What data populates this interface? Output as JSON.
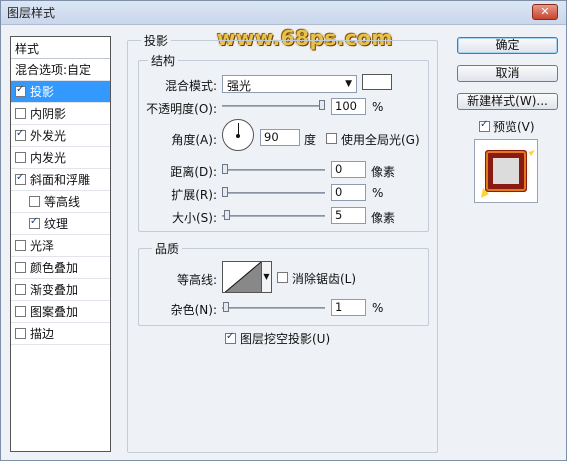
{
  "window": {
    "title": "图层样式",
    "close_icon": "close-icon"
  },
  "watermark": "www.68ps.com",
  "styles_panel": {
    "header": "样式",
    "items": [
      {
        "label": "混合选项:自定",
        "checkbox": false,
        "checked": false,
        "selected": false,
        "indent": false
      },
      {
        "label": "投影",
        "checkbox": true,
        "checked": true,
        "selected": true,
        "indent": false
      },
      {
        "label": "内阴影",
        "checkbox": true,
        "checked": false,
        "selected": false,
        "indent": false
      },
      {
        "label": "外发光",
        "checkbox": true,
        "checked": true,
        "selected": false,
        "indent": false
      },
      {
        "label": "内发光",
        "checkbox": true,
        "checked": false,
        "selected": false,
        "indent": false
      },
      {
        "label": "斜面和浮雕",
        "checkbox": true,
        "checked": true,
        "selected": false,
        "indent": false
      },
      {
        "label": "等高线",
        "checkbox": true,
        "checked": false,
        "selected": false,
        "indent": true
      },
      {
        "label": "纹理",
        "checkbox": true,
        "checked": true,
        "selected": false,
        "indent": true
      },
      {
        "label": "光泽",
        "checkbox": true,
        "checked": false,
        "selected": false,
        "indent": false
      },
      {
        "label": "颜色叠加",
        "checkbox": true,
        "checked": false,
        "selected": false,
        "indent": false
      },
      {
        "label": "渐变叠加",
        "checkbox": true,
        "checked": false,
        "selected": false,
        "indent": false
      },
      {
        "label": "图案叠加",
        "checkbox": true,
        "checked": false,
        "selected": false,
        "indent": false
      },
      {
        "label": "描边",
        "checkbox": true,
        "checked": false,
        "selected": false,
        "indent": false
      }
    ]
  },
  "drop_shadow": {
    "section_title": "投影",
    "structure": {
      "title": "结构",
      "blend_mode_label": "混合模式:",
      "blend_mode_value": "强光",
      "shadow_color": "#ffffff",
      "opacity_label": "不透明度(O):",
      "opacity_value": "100",
      "opacity_unit": "%",
      "opacity_fraction": 1.0,
      "angle_label": "角度(A):",
      "angle_value": "90",
      "angle_unit": "度",
      "global_light_label": "使用全局光(G)",
      "global_light_checked": false,
      "distance_label": "距离(D):",
      "distance_value": "0",
      "distance_unit": "像素",
      "distance_fraction": 0.0,
      "spread_label": "扩展(R):",
      "spread_value": "0",
      "spread_unit": "%",
      "spread_fraction": 0.0,
      "size_label": "大小(S):",
      "size_value": "5",
      "size_unit": "像素",
      "size_fraction": 0.02
    },
    "quality": {
      "title": "品质",
      "contour_label": "等高线:",
      "anti_alias_label": "消除锯齿(L)",
      "anti_alias_checked": false,
      "noise_label": "杂色(N):",
      "noise_value": "1",
      "noise_unit": "%",
      "noise_fraction": 0.01
    },
    "knockout_label": "图层挖空投影(U)",
    "knockout_checked": true
  },
  "buttons": {
    "ok": "确定",
    "cancel": "取消",
    "new_style": "新建样式(W)..."
  },
  "preview": {
    "label": "预览(V)",
    "checked": true
  },
  "colors": {
    "selection": "#3399ff",
    "preview_frame": "#8b1a10",
    "preview_glow": "#ffd23a"
  }
}
